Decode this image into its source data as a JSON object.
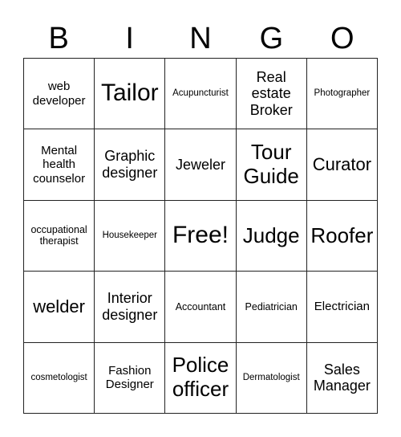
{
  "header": {
    "letters": [
      "B",
      "I",
      "N",
      "G",
      "O"
    ]
  },
  "cells": [
    [
      "web developer",
      "Tailor",
      "Acupuncturist",
      "Real estate Broker",
      "Photographer"
    ],
    [
      "Mental health counselor",
      "Graphic designer",
      "Jeweler",
      "Tour Guide",
      "Curator"
    ],
    [
      "occupational therapist",
      "Housekeeper",
      "Free!",
      "Judge",
      "Roofer"
    ],
    [
      "welder",
      "Interior designer",
      "Accountant",
      "Pediatrician",
      "Electrician"
    ],
    [
      "cosmetologist",
      "Fashion Designer",
      "Police officer",
      "Dermatologist",
      "Sales Manager"
    ]
  ]
}
